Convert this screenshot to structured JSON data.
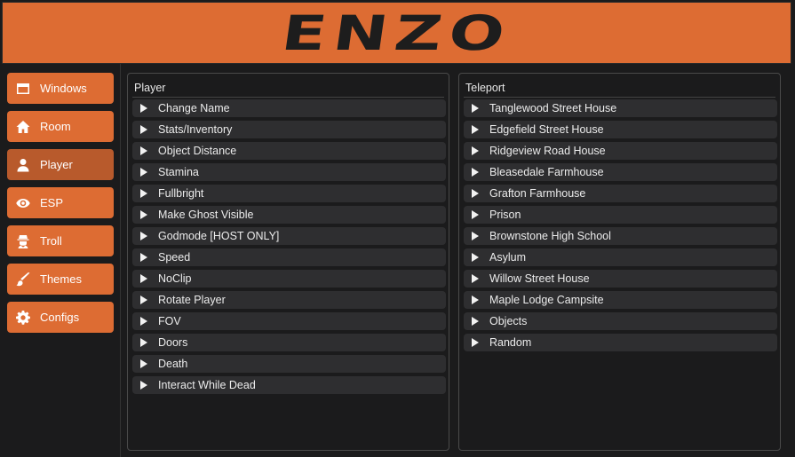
{
  "header": {
    "logo_text": "ENZO",
    "color": "#dd6c33"
  },
  "sidebar": {
    "items": [
      {
        "label": "Windows",
        "icon": "window-icon"
      },
      {
        "label": "Room",
        "icon": "home-icon"
      },
      {
        "label": "Player",
        "icon": "user-icon",
        "active": true
      },
      {
        "label": "ESP",
        "icon": "eye-icon"
      },
      {
        "label": "Troll",
        "icon": "spy-icon"
      },
      {
        "label": "Themes",
        "icon": "paintbrush-icon"
      },
      {
        "label": "Configs",
        "icon": "gear-icon"
      }
    ]
  },
  "player_panel": {
    "title": "Player",
    "items": [
      "Change Name",
      "Stats/Inventory",
      "Object Distance",
      "Stamina",
      "Fullbright",
      "Make Ghost Visible",
      "Godmode [HOST ONLY]",
      "Speed",
      "NoClip",
      "Rotate Player",
      "FOV",
      "Doors",
      "Death",
      "Interact While Dead"
    ]
  },
  "teleport_panel": {
    "title": "Teleport",
    "items": [
      "Tanglewood Street House",
      "Edgefield Street House",
      "Ridgeview Road House",
      "Bleasedale Farmhouse",
      "Grafton Farmhouse",
      "Prison",
      "Brownstone High School",
      "Asylum",
      "Willow Street House",
      "Maple Lodge Campsite",
      "Objects",
      "Random"
    ]
  }
}
